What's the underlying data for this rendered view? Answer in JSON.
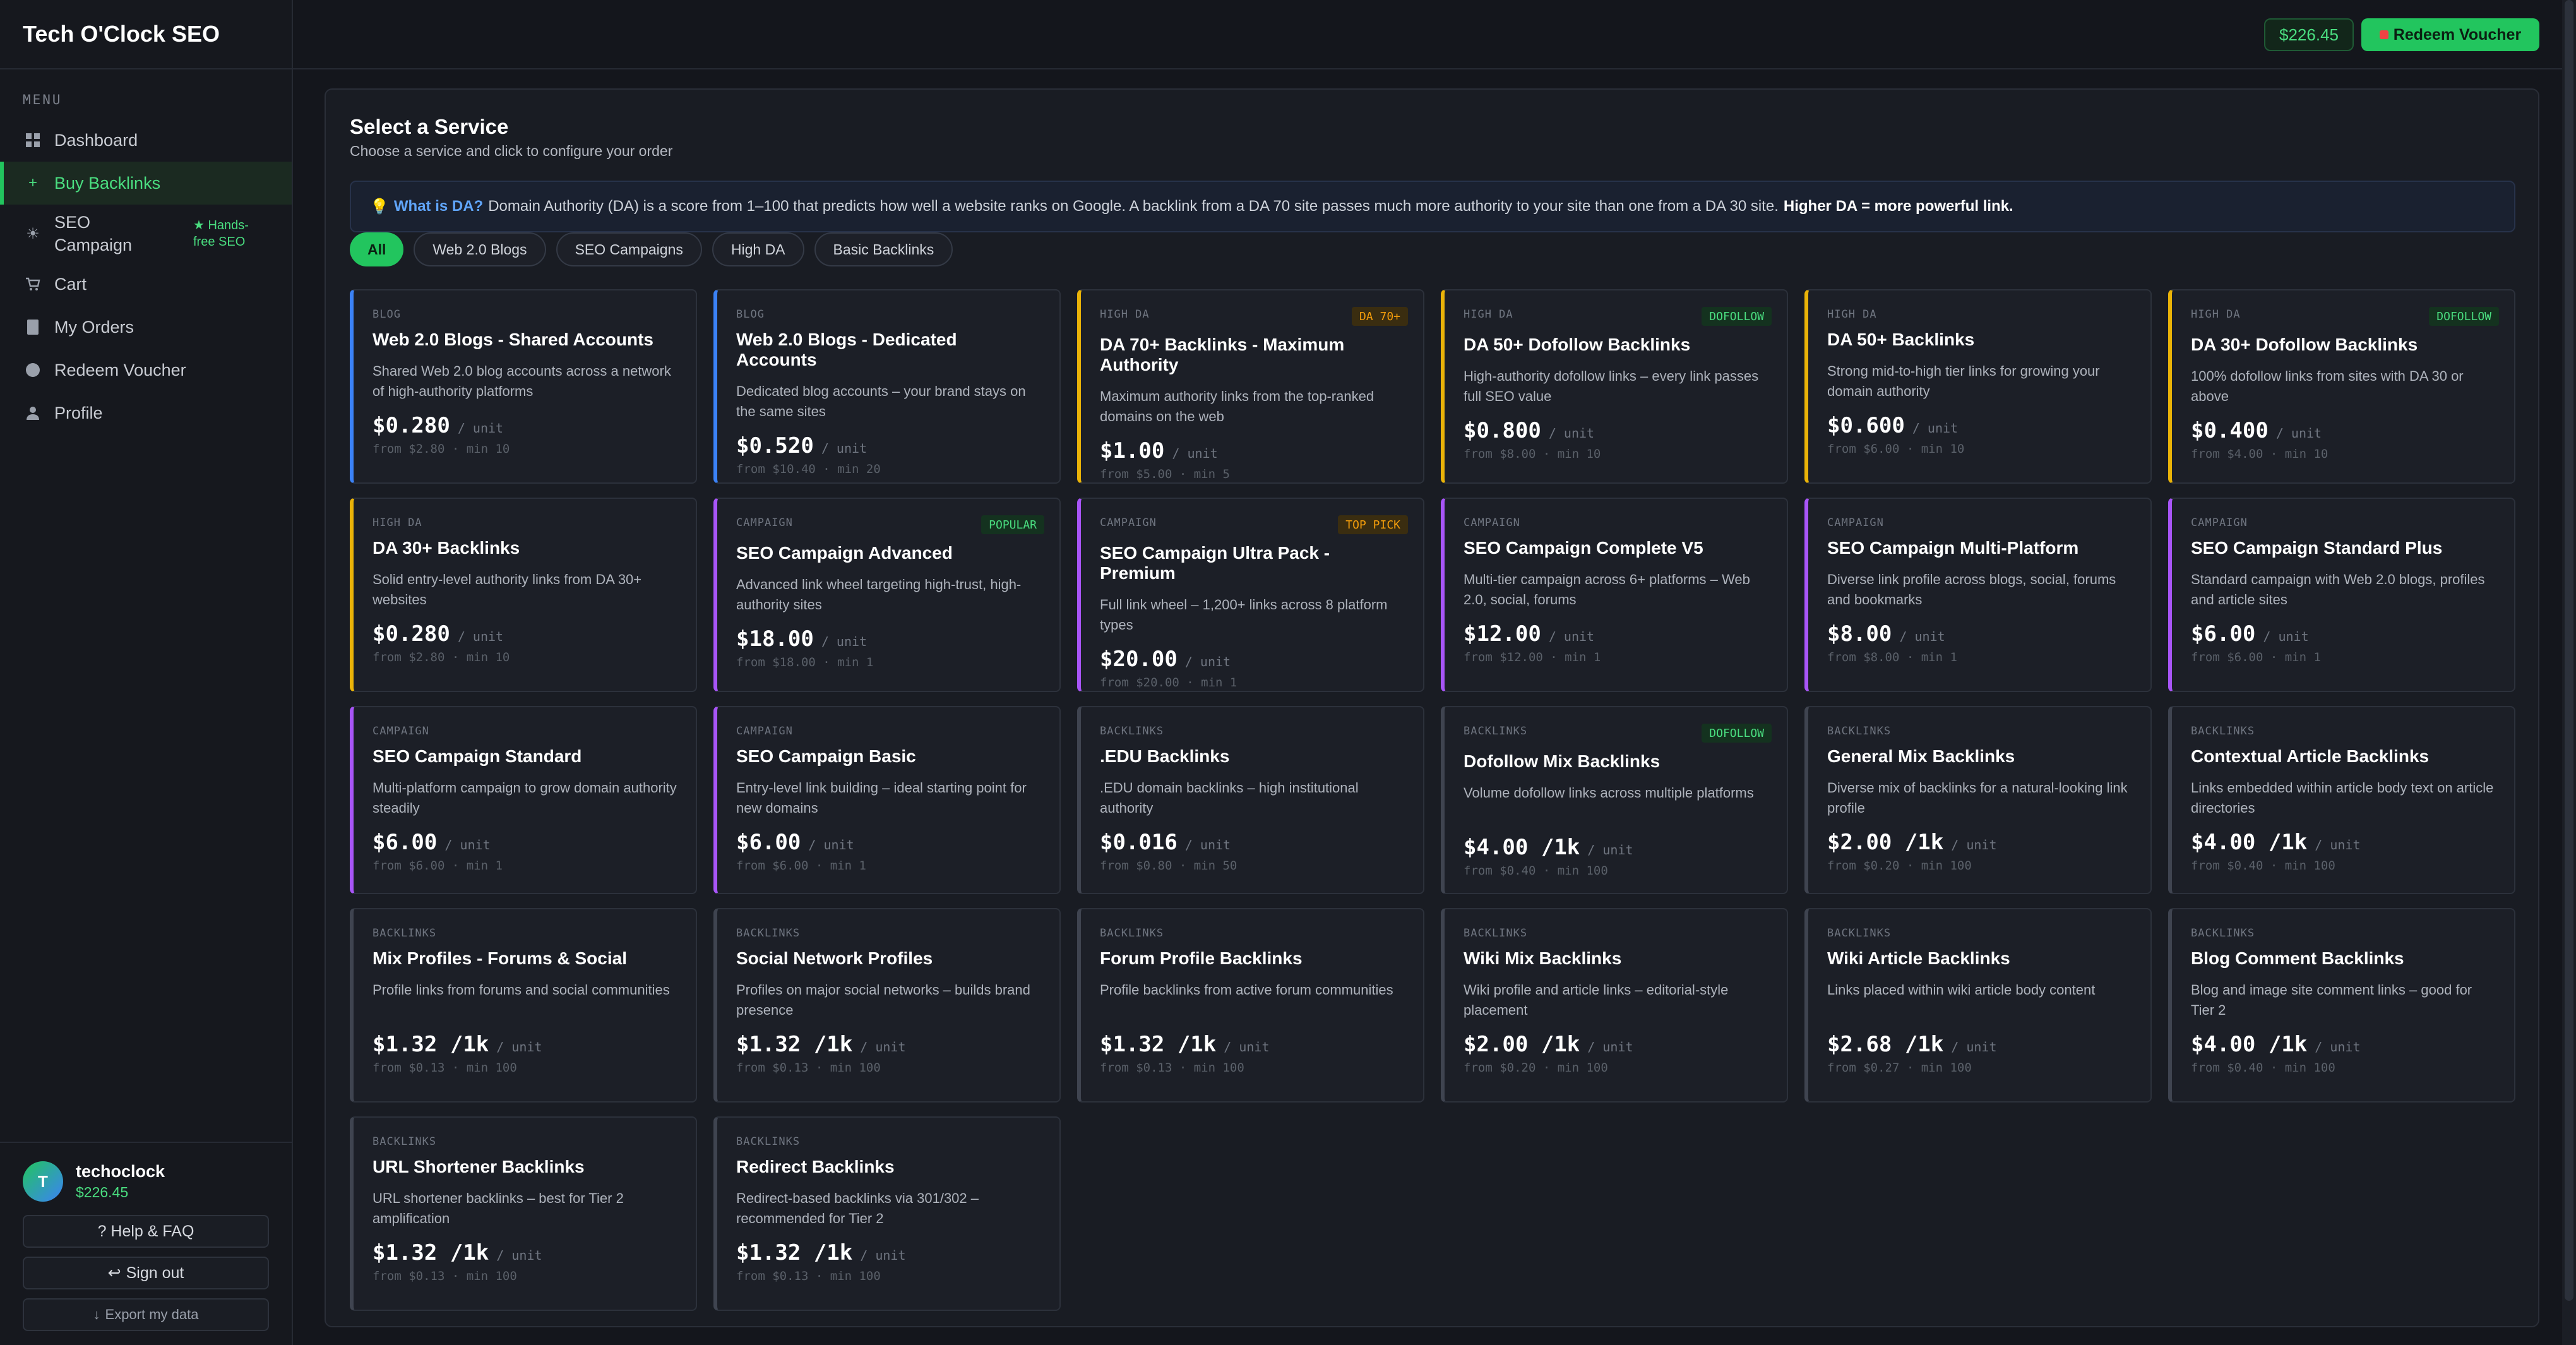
{
  "app": {
    "title": "Tech O'Clock SEO"
  },
  "sidebar": {
    "menu_heading": "MENU",
    "items": [
      {
        "label": "Dashboard"
      },
      {
        "label": "Buy Backlinks"
      },
      {
        "label": "SEO Campaign",
        "badge": "★ Hands-free SEO"
      },
      {
        "label": "Cart"
      },
      {
        "label": "My Orders"
      },
      {
        "label": "Redeem Voucher"
      },
      {
        "label": "Profile"
      }
    ],
    "user": {
      "initial": "T",
      "name": "techoclock",
      "balance": "$226.45"
    },
    "help_label": "? Help & FAQ",
    "signout_label": "Sign out",
    "signout_glyph": "↩",
    "export_label": "Export my data",
    "export_glyph": "↓"
  },
  "topbar": {
    "balance": "$226.45",
    "redeem_label": "Redeem Voucher"
  },
  "main": {
    "title": "Select a Service",
    "subtitle": "Choose a service and click to configure your order",
    "info": {
      "bulb": "💡",
      "question": "What is DA?",
      "text": "Domain Authority (DA) is a score from 1–100 that predicts how well a website ranks on Google. A backlink from a DA 70 site passes much more authority to your site than one from a DA 30 site.",
      "strong": "Higher DA = more powerful link."
    },
    "filters": [
      "All",
      "Web 2.0 Blogs",
      "SEO Campaigns",
      "High DA",
      "Basic Backlinks"
    ],
    "services": [
      {
        "cat": "BLOG",
        "title": "Web 2.0 Blogs - Shared Accounts",
        "desc": "Shared Web 2.0 blog accounts across a network of high-authority platforms",
        "price": "$0.280",
        "unit": "/ unit",
        "from": "from $2.80 · min 10",
        "badge": "",
        "kind": "blog"
      },
      {
        "cat": "BLOG",
        "title": "Web 2.0 Blogs - Dedicated Accounts",
        "desc": "Dedicated blog accounts – your brand stays on the same sites",
        "price": "$0.520",
        "unit": "/ unit",
        "from": "from $10.40 · min 20",
        "badge": "",
        "kind": "blog"
      },
      {
        "cat": "HIGH DA",
        "title": "DA 70+ Backlinks - Maximum Authority",
        "desc": "Maximum authority links from the top-ranked domains on the web",
        "price": "$1.00",
        "unit": "/ unit",
        "from": "from $5.00 · min 5",
        "badge": "DA 70+",
        "badge_style": "amber",
        "kind": "hda"
      },
      {
        "cat": "HIGH DA",
        "title": "DA 50+ Dofollow Backlinks",
        "desc": "High-authority dofollow links – every link passes full SEO value",
        "price": "$0.800",
        "unit": "/ unit",
        "from": "from $8.00 · min 10",
        "badge": "DOFOLLOW",
        "badge_style": "green",
        "kind": "hda"
      },
      {
        "cat": "HIGH DA",
        "title": "DA 50+ Backlinks",
        "desc": "Strong mid-to-high tier links for growing your domain authority",
        "price": "$0.600",
        "unit": "/ unit",
        "from": "from $6.00 · min 10",
        "badge": "",
        "kind": "hda"
      },
      {
        "cat": "HIGH DA",
        "title": "DA 30+ Dofollow Backlinks",
        "desc": "100% dofollow links from sites with DA 30 or above",
        "price": "$0.400",
        "unit": "/ unit",
        "from": "from $4.00 · min 10",
        "badge": "DOFOLLOW",
        "badge_style": "green",
        "kind": "hda"
      },
      {
        "cat": "HIGH DA",
        "title": "DA 30+ Backlinks",
        "desc": "Solid entry-level authority links from DA 30+ websites",
        "price": "$0.280",
        "unit": "/ unit",
        "from": "from $2.80 · min 10",
        "badge": "",
        "kind": "hda"
      },
      {
        "cat": "CAMPAIGN",
        "title": "SEO Campaign Advanced",
        "desc": "Advanced link wheel targeting high-trust, high-authority sites",
        "price": "$18.00",
        "unit": "/ unit",
        "from": "from $18.00 · min 1",
        "badge": "POPULAR",
        "badge_style": "green",
        "kind": "camp"
      },
      {
        "cat": "CAMPAIGN",
        "title": "SEO Campaign Ultra Pack - Premium",
        "desc": "Full link wheel – 1,200+ links across 8 platform types",
        "price": "$20.00",
        "unit": "/ unit",
        "from": "from $20.00 · min 1",
        "badge": "TOP PICK",
        "badge_style": "amber",
        "kind": "camp"
      },
      {
        "cat": "CAMPAIGN",
        "title": "SEO Campaign Complete V5",
        "desc": "Multi-tier campaign across 6+ platforms – Web 2.0, social, forums",
        "price": "$12.00",
        "unit": "/ unit",
        "from": "from $12.00 · min 1",
        "badge": "",
        "kind": "camp"
      },
      {
        "cat": "CAMPAIGN",
        "title": "SEO Campaign Multi-Platform",
        "desc": "Diverse link profile across blogs, social, forums and bookmarks",
        "price": "$8.00",
        "unit": "/ unit",
        "from": "from $8.00 · min 1",
        "badge": "",
        "kind": "camp"
      },
      {
        "cat": "CAMPAIGN",
        "title": "SEO Campaign Standard Plus",
        "desc": "Standard campaign with Web 2.0 blogs, profiles and article sites",
        "price": "$6.00",
        "unit": "/ unit",
        "from": "from $6.00 · min 1",
        "badge": "",
        "kind": "camp"
      },
      {
        "cat": "CAMPAIGN",
        "title": "SEO Campaign Standard",
        "desc": "Multi-platform campaign to grow domain authority steadily",
        "price": "$6.00",
        "unit": "/ unit",
        "from": "from $6.00 · min 1",
        "badge": "",
        "kind": "camp"
      },
      {
        "cat": "CAMPAIGN",
        "title": "SEO Campaign Basic",
        "desc": "Entry-level link building – ideal starting point for new domains",
        "price": "$6.00",
        "unit": "/ unit",
        "from": "from $6.00 · min 1",
        "badge": "",
        "kind": "camp"
      },
      {
        "cat": "BACKLINKS",
        "title": ".EDU Backlinks",
        "desc": ".EDU domain backlinks – high institutional authority",
        "price": "$0.016",
        "unit": "/ unit",
        "from": "from $0.80 · min 50",
        "badge": "",
        "kind": "back"
      },
      {
        "cat": "BACKLINKS",
        "title": "Dofollow Mix Backlinks",
        "desc": "Volume dofollow links across multiple platforms",
        "price": "$4.00 /1k",
        "unit": "/ unit",
        "from": "from $0.40 · min 100",
        "badge": "DOFOLLOW",
        "badge_style": "green",
        "kind": "back"
      },
      {
        "cat": "BACKLINKS",
        "title": "General Mix Backlinks",
        "desc": "Diverse mix of backlinks for a natural-looking link profile",
        "price": "$2.00 /1k",
        "unit": "/ unit",
        "from": "from $0.20 · min 100",
        "badge": "",
        "kind": "back"
      },
      {
        "cat": "BACKLINKS",
        "title": "Contextual Article Backlinks",
        "desc": "Links embedded within article body text on article directories",
        "price": "$4.00 /1k",
        "unit": "/ unit",
        "from": "from $0.40 · min 100",
        "badge": "",
        "kind": "back"
      },
      {
        "cat": "BACKLINKS",
        "title": "Mix Profiles - Forums & Social",
        "desc": "Profile links from forums and social communities",
        "price": "$1.32 /1k",
        "unit": "/ unit",
        "from": "from $0.13 · min 100",
        "badge": "",
        "kind": "back"
      },
      {
        "cat": "BACKLINKS",
        "title": "Social Network Profiles",
        "desc": "Profiles on major social networks – builds brand presence",
        "price": "$1.32 /1k",
        "unit": "/ unit",
        "from": "from $0.13 · min 100",
        "badge": "",
        "kind": "back"
      },
      {
        "cat": "BACKLINKS",
        "title": "Forum Profile Backlinks",
        "desc": "Profile backlinks from active forum communities",
        "price": "$1.32 /1k",
        "unit": "/ unit",
        "from": "from $0.13 · min 100",
        "badge": "",
        "kind": "back"
      },
      {
        "cat": "BACKLINKS",
        "title": "Wiki Mix Backlinks",
        "desc": "Wiki profile and article links – editorial-style placement",
        "price": "$2.00 /1k",
        "unit": "/ unit",
        "from": "from $0.20 · min 100",
        "badge": "",
        "kind": "back"
      },
      {
        "cat": "BACKLINKS",
        "title": "Wiki Article Backlinks",
        "desc": "Links placed within wiki article body content",
        "price": "$2.68 /1k",
        "unit": "/ unit",
        "from": "from $0.27 · min 100",
        "badge": "",
        "kind": "back"
      },
      {
        "cat": "BACKLINKS",
        "title": "Blog Comment Backlinks",
        "desc": "Blog and image site comment links – good for Tier 2",
        "price": "$4.00 /1k",
        "unit": "/ unit",
        "from": "from $0.40 · min 100",
        "badge": "",
        "kind": "back"
      },
      {
        "cat": "BACKLINKS",
        "title": "URL Shortener Backlinks",
        "desc": "URL shortener backlinks – best for Tier 2 amplification",
        "price": "$1.32 /1k",
        "unit": "/ unit",
        "from": "from $0.13 · min 100",
        "badge": "",
        "kind": "back"
      },
      {
        "cat": "BACKLINKS",
        "title": "Redirect Backlinks",
        "desc": "Redirect-based backlinks via 301/302 – recommended for Tier 2",
        "price": "$1.32 /1k",
        "unit": "/ unit",
        "from": "from $0.13 · min 100",
        "badge": "",
        "kind": "back"
      }
    ]
  },
  "colors": {
    "accent": "#22c55e",
    "blog": "#3b82f6",
    "high_da": "#eab308",
    "campaign": "#a855f7",
    "backlinks": "#3f4450"
  }
}
